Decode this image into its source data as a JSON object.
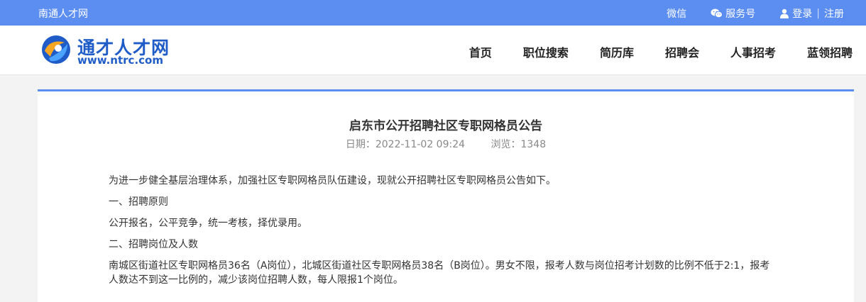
{
  "topbar": {
    "site_name": "南通人才网",
    "wechat": "微信",
    "service": "服务号",
    "login": "登录",
    "register": "注册",
    "divider": "|"
  },
  "header": {
    "logo_cn": "通才人才网",
    "logo_en": "www.ntrc.com",
    "nav": [
      "首页",
      "职位搜索",
      "简历库",
      "招聘会",
      "人事招考",
      "蓝领招聘"
    ]
  },
  "article": {
    "title": "启东市公开招聘社区专职网格员公告",
    "date_label": "日期：",
    "date": "2022-11-02 09:24",
    "views_label": "浏览：",
    "views": "1348",
    "paragraphs": [
      "为进一步健全基层治理体系，加强社区专职网格员队伍建设，现就公开招聘社区专职网格员公告如下。",
      "一、招聘原则",
      "公开报名，公平竞争，统一考核，择优录用。",
      "二、招聘岗位及人数",
      "南城区街道社区专职网格员36名（A岗位），北城区街道社区专职网格员38名（B岗位）。男女不限，报考人数与岗位招考计划数的比例不低于2:1，报考人数达不到这一比例的，减少该岗位招聘人数，每人限报1个岗位。"
    ]
  },
  "colors": {
    "topbar_bg": "#5b8ef0",
    "brand_blue": "#1f5cc7"
  }
}
